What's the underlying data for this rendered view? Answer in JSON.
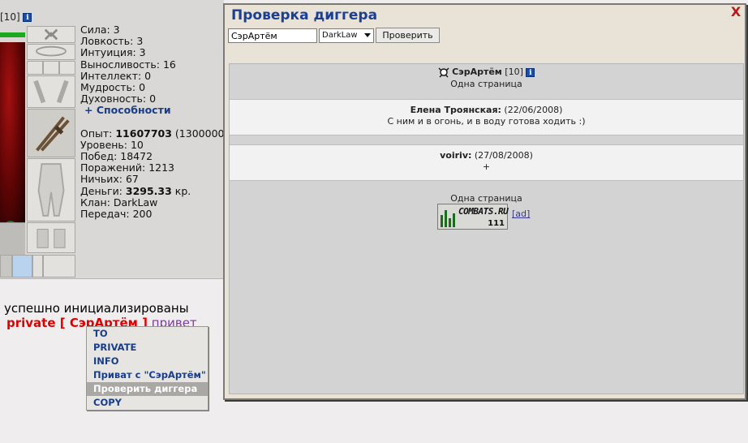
{
  "character": {
    "level_text": "[10]",
    "info_icon": "i",
    "stats": [
      "Сила: 3",
      "Ловкость: 3",
      "Интуиция: 3",
      "Выносливость: 16",
      "Интеллект: 0",
      "Мудрость: 0",
      "Духовность: 0"
    ],
    "abilities_link": "+ Способности",
    "exp_label": "Опыт: ",
    "exp_value": "11607703",
    "exp_next": " (1300000",
    "level": "Уровень: 10",
    "wins": "Побед: 18472",
    "losses": "Поражений: 1213",
    "draws": "Ничьих: 67",
    "money_label": "Деньги: ",
    "money_value": "3295.33",
    "money_unit": " кр.",
    "clan": "Клан: DarkLaw",
    "transfers": "Передач: 200"
  },
  "chat": {
    "line1": "успешно инициализированы",
    "private_tag": "private [ СэрАртём ]",
    "message": " привет"
  },
  "context_menu": {
    "items": [
      "TO",
      "PRIVATE",
      "INFO",
      "Приват с \"СэрАртём\"",
      "Проверить диггера",
      "COPY"
    ],
    "active_index": 4
  },
  "dialog": {
    "title": "Проверка диггера",
    "close_label": "X",
    "search_value": "СэрАртём",
    "clan_select_value": "DarkLaw",
    "check_button": "Проверить",
    "user_name": "СэрАртём",
    "user_level": " [10]",
    "pages_text": "Одна страница",
    "entries": [
      {
        "author": "Елена Троянская:",
        "date": " (22/06/2008)",
        "text": "С ним и в огонь, и в воду готова ходить :)"
      },
      {
        "author": "voiriv:",
        "date": " (27/08/2008)",
        "text": "+"
      }
    ],
    "footer_pages": "Одна страница",
    "counter_brand": "COMBATS.RU",
    "counter_value": "111",
    "ad_link": "[ad]"
  }
}
